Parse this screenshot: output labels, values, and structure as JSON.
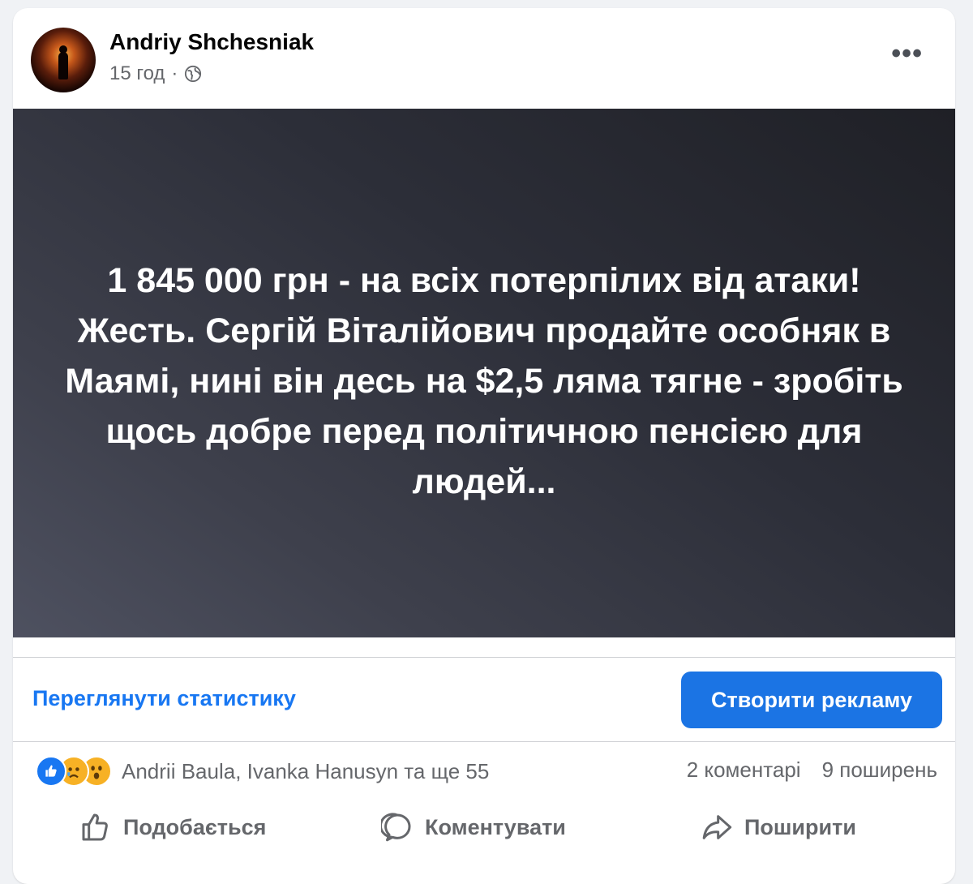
{
  "post": {
    "author": "Andriy Shchesniak",
    "time": "15 год",
    "separator": "·",
    "privacy_icon": "globe-icon",
    "more_icon": "•••",
    "text": "1 845 000 грн - на всіх потерпілих від атаки! Жесть. Сергій Віталійович продайте особняк в Маямі, нині він десь на $2,5 ляма тягне - зробіть щось добре перед політичною пенсією для людей..."
  },
  "insights": {
    "stats_link": "Переглянути статистику",
    "ad_button": "Створити рекламу"
  },
  "engagement": {
    "reaction_icons": [
      "like-icon",
      "sad-icon",
      "wow-icon"
    ],
    "reactors": "Andrii Baula, Ivanka Hanusyn та ще 55",
    "comments": "2 коментарі",
    "shares": "9 поширень"
  },
  "actions": {
    "like": "Подобається",
    "comment": "Коментувати",
    "share": "Поширити"
  },
  "colors": {
    "accent": "#1877f2",
    "ad_button": "#1b74e4",
    "secondary_text": "#65676b"
  }
}
